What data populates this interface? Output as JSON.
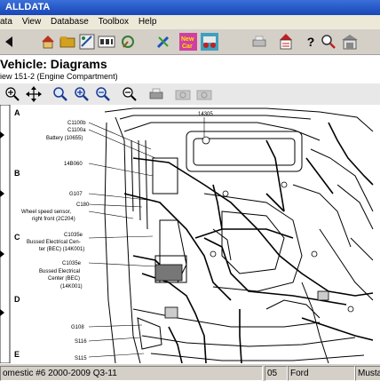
{
  "window": {
    "title": "ALLDATA"
  },
  "menu": {
    "items": [
      "ata",
      "View",
      "Database",
      "Toolbox",
      "Help"
    ]
  },
  "view": {
    "title": "Vehicle:  Diagrams",
    "subtitle": "iew 151-2 (Engine Compartment)"
  },
  "diagram": {
    "zones": [
      "A",
      "B",
      "C",
      "D",
      "E"
    ],
    "labels": {
      "l14305": "14305",
      "c1100b": "C1100b",
      "c1100a": "C1100a",
      "battery": "Battery (10655)",
      "l14b060": "14B060",
      "g107": "G107",
      "c180": "C180",
      "wss1": "Wheel speed sensor,",
      "wss2": "right front (2C204)",
      "c1035e": "C1035e",
      "bec1a": "Bussed Electrical Cen-",
      "bec1b": "ter (BEC) (14K001)",
      "c1035e2": "C1035e",
      "bec2a": "Bussed Electrical",
      "bec2b": "Center (BEC)",
      "bec2c": "(14K001)",
      "g108": "G108",
      "s116": "S116",
      "s115": "S115"
    }
  },
  "status": {
    "left": "omestic #6 2000-2009 Q3-11",
    "code": "05",
    "make": "Ford",
    "model": "Musta"
  },
  "colors": {
    "titlebar": "#1846b8",
    "chrome": "#d4d0c8",
    "menubar": "#ece9d8"
  }
}
